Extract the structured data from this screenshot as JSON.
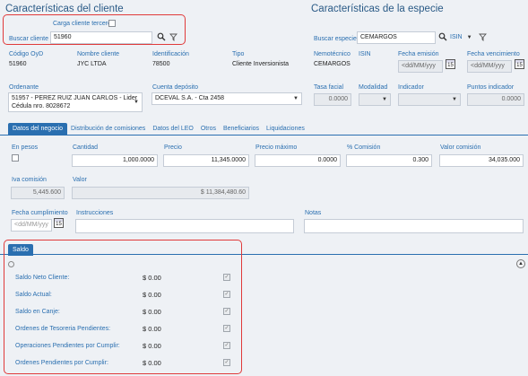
{
  "client": {
    "title": "Características del cliente",
    "third_party_label": "Carga cliente tercero",
    "search_label": "Buscar cliente",
    "search_value": "51960",
    "code_label": "Código OyD",
    "code_value": "51960",
    "name_label": "Nombre cliente",
    "name_value": "JYC LTDA",
    "id_label": "Identificación",
    "id_value": "78500",
    "type_label": "Tipo",
    "type_value": "Cliente Inversionista",
    "ordenante_label": "Ordenante",
    "ordenante_line1": "51957 - PEREZ RUIZ JUAN  CARLOS - Lider",
    "ordenante_line2": "Cédula nro. 8028672",
    "deposit_label": "Cuenta depósito",
    "deposit_value": "DCEVAL S.A. - Cta 2458"
  },
  "species": {
    "title": "Características de la especie",
    "search_label": "Buscar especie",
    "search_value": "CEMARGOS",
    "isin_select": "ISIN",
    "nemo_label": "Nemotécnico",
    "nemo_value": "CEMARGOS",
    "isin_label": "ISIN",
    "issue_label": "Fecha emisión",
    "issue_placeholder": "<dd/MM/yyy",
    "expiry_label": "Fecha vencimiento",
    "expiry_placeholder": "<dd/MM/yyy",
    "cal_day": "15",
    "rate_label": "Tasa facial",
    "rate_value": "0.0000",
    "modality_label": "Modalidad",
    "indicator_label": "Indicador",
    "points_label": "Puntos indicador",
    "points_value": "0.0000"
  },
  "tabs": [
    "Datos del negocio",
    "Distribución de comisiones",
    "Datos del LEO",
    "Otros",
    "Beneficiarios",
    "Liquidaciones"
  ],
  "business": {
    "en_pesos_label": "En pesos",
    "qty_label": "Cantidad",
    "qty_value": "1,000.0000",
    "price_label": "Precio",
    "price_value": "11,345.0000",
    "max_price_label": "Precio máximo",
    "max_price_value": "0.0000",
    "commission_label": "% Comisión",
    "commission_value": "0.300",
    "commission_value_label": "Valor comisión",
    "commission_value_value": "34,035.000",
    "iva_label": "Iva comisión",
    "iva_value": "5,445.600",
    "valor_label": "Valor",
    "valor_value": "$ 11,384,480.60",
    "fulfil_label": "Fecha cumplimiento",
    "fulfil_placeholder": "<dd/MM/yyy",
    "cal_day": "15",
    "instructions_label": "Instrucciones",
    "notes_label": "Notas"
  },
  "saldo": {
    "tab_label": "Saldo",
    "rows": [
      {
        "label": "Saldo Neto Cliente:",
        "value": "$ 0.00"
      },
      {
        "label": "Saldo Actual:",
        "value": "$ 0.00"
      },
      {
        "label": "Saldo en Canje:",
        "value": "$ 0.00"
      },
      {
        "label": "Ordenes de Tesoreria Pendientes:",
        "value": "$ 0.00"
      },
      {
        "label": "Operaciones Pendientes por Cumplir:",
        "value": "$ 0.00"
      },
      {
        "label": "Ordenes Pendientes por Cumplir:",
        "value": "$ 0.00"
      }
    ]
  },
  "icons": {
    "search": "search-icon",
    "clear": "clear-filter-icon",
    "dropdown": "chevron-down-icon",
    "calendar": "calendar-icon",
    "collapse": "chevron-up-icon"
  }
}
